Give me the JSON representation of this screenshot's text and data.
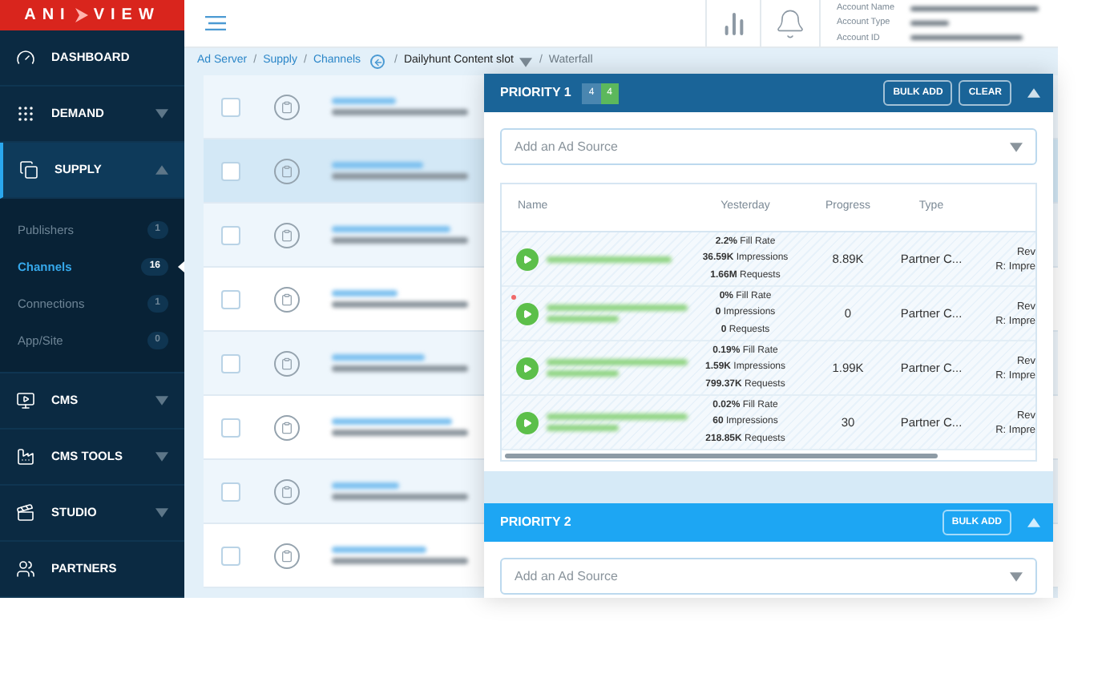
{
  "logo": {
    "left": "ANI",
    "right": "VIEW"
  },
  "sidebar": {
    "items": [
      {
        "label": "DASHBOARD",
        "kind": "link",
        "selected": false
      },
      {
        "label": "DEMAND",
        "kind": "group",
        "expanded": false,
        "selected": false
      },
      {
        "label": "SUPPLY",
        "kind": "group",
        "expanded": true,
        "selected": true,
        "children": [
          {
            "label": "Publishers",
            "count": "1",
            "selected": false
          },
          {
            "label": "Channels",
            "count": "16",
            "selected": true
          },
          {
            "label": "Connections",
            "count": "1",
            "selected": false
          },
          {
            "label": "App/Site",
            "count": "0",
            "selected": false
          }
        ]
      },
      {
        "label": "CMS",
        "kind": "group",
        "expanded": false,
        "selected": false
      },
      {
        "label": "CMS TOOLS",
        "kind": "group",
        "expanded": false,
        "selected": false
      },
      {
        "label": "STUDIO",
        "kind": "group",
        "expanded": false,
        "selected": false
      },
      {
        "label": "PARTNERS",
        "kind": "link",
        "selected": false
      }
    ]
  },
  "header": {
    "account_labels": [
      "Account Name",
      "Account Type",
      "Account ID"
    ]
  },
  "breadcrumb": [
    {
      "kind": "link",
      "text": "Ad Server"
    },
    {
      "kind": "separator",
      "text": "/"
    },
    {
      "kind": "link",
      "text": "Supply"
    },
    {
      "kind": "separator",
      "text": "/"
    },
    {
      "kind": "link",
      "text": "Channels"
    },
    {
      "kind": "back"
    },
    {
      "kind": "separator",
      "text": "/"
    },
    {
      "kind": "dropdown",
      "text": "Dailyhunt Content slot"
    },
    {
      "kind": "separator",
      "text": "/"
    },
    {
      "kind": "current",
      "text": "Waterfall"
    }
  ],
  "channel_rows": [
    {
      "selected": false
    },
    {
      "selected": true
    },
    {
      "selected": false
    },
    {
      "selected": false
    },
    {
      "selected": false
    },
    {
      "selected": false
    },
    {
      "selected": false
    },
    {
      "selected": false
    }
  ],
  "priorities": [
    {
      "title": "PRIORITY 1",
      "kind": "active",
      "badges": [
        {
          "text": "4",
          "color": "#4a86b0"
        },
        {
          "text": "4",
          "color": "#5cb85c"
        }
      ],
      "buttons": [
        "BULK ADD",
        "CLEAR"
      ],
      "placeholder": "Add an Ad Source",
      "table": {
        "columns": [
          "Name",
          "Yesterday",
          "Progress",
          "Type"
        ],
        "rows": [
          {
            "flagged": false,
            "yesterday": [
              "**2.2%** Fill Rate",
              "**36.59K** Impressions",
              "**1.66M** Requests"
            ],
            "progress": "8.89K",
            "type": "Partner C...",
            "column_5": [
              "Rev",
              "R: Impre"
            ]
          },
          {
            "flagged": true,
            "yesterday": [
              "**0%** Fill Rate",
              "**0** Impressions",
              "**0** Requests"
            ],
            "progress": "0",
            "type": "Partner C...",
            "column_5": [
              "Rev",
              "R: Impre"
            ]
          },
          {
            "flagged": false,
            "yesterday": [
              "**0.19%** Fill Rate",
              "**1.59K** Impressions",
              "**799.37K** Requests"
            ],
            "progress": "1.99K",
            "type": "Partner C...",
            "column_5": [
              "Rev",
              "R: Impre"
            ]
          },
          {
            "flagged": false,
            "yesterday": [
              "**0.02%** Fill Rate",
              "**60** Impressions",
              "**218.85K** Requests"
            ],
            "progress": "30",
            "type": "Partner C...",
            "column_5": [
              "Rev",
              "R: Impre"
            ]
          }
        ]
      }
    },
    {
      "title": "PRIORITY 2",
      "kind": "plain",
      "buttons": [
        "BULK ADD"
      ],
      "placeholder": "Add an Ad Source"
    }
  ]
}
